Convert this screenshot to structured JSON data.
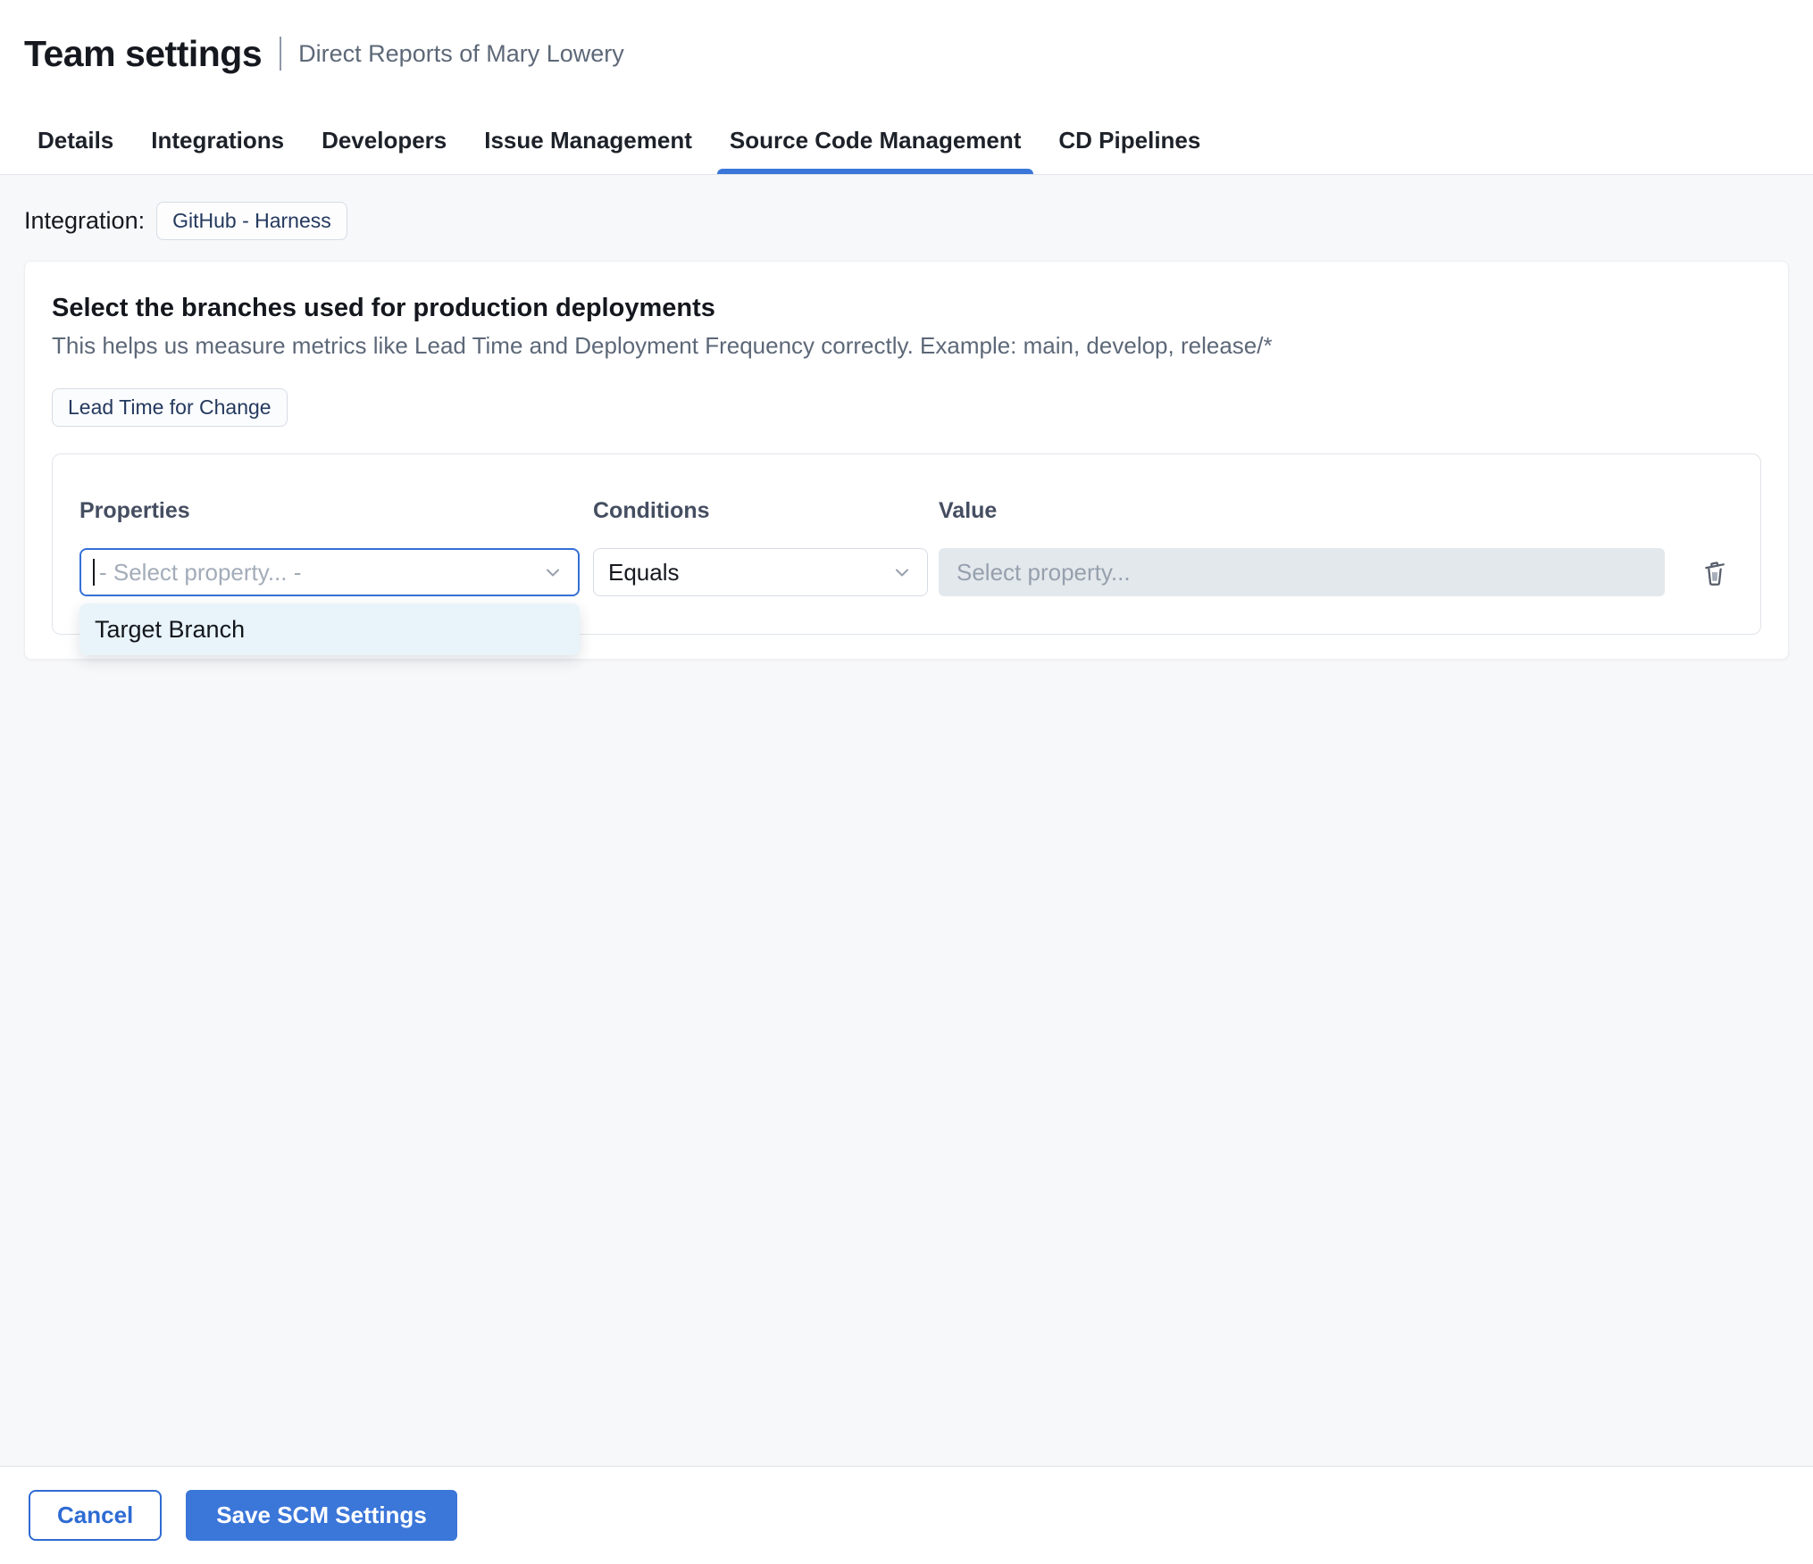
{
  "header": {
    "title": "Team settings",
    "subtitle": "Direct Reports of Mary Lowery"
  },
  "tabs": [
    {
      "label": "Details"
    },
    {
      "label": "Integrations"
    },
    {
      "label": "Developers"
    },
    {
      "label": "Issue Management"
    },
    {
      "label": "Source Code Management",
      "active": true
    },
    {
      "label": "CD Pipelines"
    }
  ],
  "integration": {
    "label": "Integration:",
    "chip": "GitHub - Harness"
  },
  "scm_card": {
    "title": "Select the branches used for production deployments",
    "description": "This helps us measure metrics like Lead Time and Deployment Frequency correctly. Example: main, develop, release/*",
    "metric_chip": "Lead Time for Change",
    "rule_builder": {
      "properties_label": "Properties",
      "conditions_label": "Conditions",
      "value_label": "Value",
      "properties_placeholder": "- Select property... -",
      "conditions_selected": "Equals",
      "value_placeholder": "Select property...",
      "properties_options": [
        "Target Branch"
      ]
    }
  },
  "footer": {
    "cancel_label": "Cancel",
    "save_label": "Save SCM Settings"
  },
  "colors": {
    "accent_blue": "#3b76d9",
    "focused_field_border": "#3470d6",
    "cancel_blue": "#2e6bd3",
    "chip_text": "#24395e",
    "dropdown_bg": "#e9f4fa",
    "disabled_input_bg": "#e3e8ec",
    "page_bg": "#f7f8f9"
  }
}
